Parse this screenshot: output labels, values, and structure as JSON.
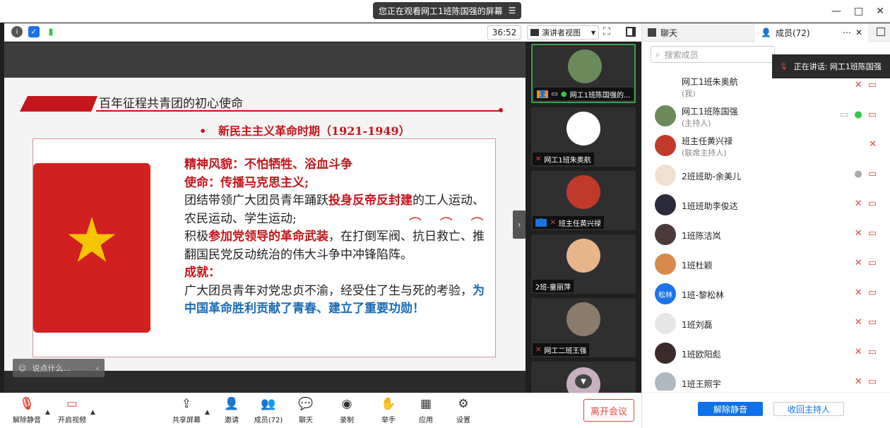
{
  "titlebar": {
    "share_notice": "您正在观看网工1班陈国强的屏幕",
    "menu_icon": "menu-lines-icon",
    "controls": [
      "—",
      "□",
      "✕"
    ]
  },
  "subbar": {
    "timer": "36:52",
    "view_select": "演讲者视图"
  },
  "slide": {
    "banner_title": "百年征程共青团的初心使命",
    "subtitle_bullet": "•",
    "subtitle": "新民主主义革命时期（1921-1949）",
    "spirit_label": "精神风貌：不怕牺牲、浴血斗争",
    "mission_label": "使命：传播马克思主义;",
    "p1_a": "团结带领广大团员青年踊跃",
    "p1_em": "投身反帝反封建",
    "p1_b": "的工人运动、农民运动、学生运动;",
    "p2_a": "积极",
    "p2_em": "参加党领导的革命武装",
    "p2_b": "，在打倒军阀、抗日救亡、推翻国民党反动统治的伟大斗争中冲锋陷阵。",
    "achieve_label": "成就：",
    "p3_a": "广大团员青年对党忠贞不渝，经受住了生与死的考验，",
    "p3_em": "为中国革命胜利贡献了青春、建立了重要功勋！"
  },
  "chat_input": {
    "placeholder": "说点什么...",
    "collapse": "‹"
  },
  "video_tiles": [
    {
      "name": "网工1班陈国强的...",
      "active": true,
      "muted": false,
      "avatar_color": "#6a8a5a"
    },
    {
      "name": "网工1班朱奥航",
      "active": false,
      "muted": true,
      "avatar_color": "#ffffff"
    },
    {
      "name": "班主任黄兴禄",
      "active": false,
      "muted": true,
      "avatar_color": "#c0392b"
    },
    {
      "name": "2班-童丽萍",
      "active": false,
      "muted": false,
      "avatar_color": "#e8b48a"
    },
    {
      "name": "网工二班王强",
      "active": false,
      "muted": true,
      "avatar_color": "#8a7b6b"
    }
  ],
  "panel": {
    "tab_chat": "聊天",
    "tab_members": "成员(72)",
    "search_placeholder": "搜索成员",
    "speaking": "正在讲话: 网工1班陈国强",
    "members": [
      {
        "name": "网工1班朱奥航",
        "role": "(我)",
        "avatar_color": "#ffffff",
        "avatar_text": "",
        "icons": [
          "mute",
          "video-off"
        ]
      },
      {
        "name": "网工1班陈国强",
        "role": "(主持人)",
        "avatar_color": "#6a8a5a",
        "avatar_text": "",
        "icons": [
          "screen",
          "mic-on",
          "video-off"
        ]
      },
      {
        "name": "班主任黄兴禄",
        "role": "(联席主持人)",
        "avatar_color": "#c0392b",
        "avatar_text": "",
        "icons": [
          "mute"
        ]
      },
      {
        "name": "2班班助-余美儿",
        "role": "",
        "avatar_color": "#f0e0d0",
        "avatar_text": "",
        "icons": [
          "mic-gray",
          "video-off"
        ]
      },
      {
        "name": "1班班助李俊达",
        "role": "",
        "avatar_color": "#2a2a3a",
        "avatar_text": "",
        "icons": [
          "mute",
          "video-off"
        ]
      },
      {
        "name": "1班陈洁岚",
        "role": "",
        "avatar_color": "#4a3a3a",
        "avatar_text": "",
        "icons": [
          "mute",
          "video-off"
        ]
      },
      {
        "name": "1班杜颖",
        "role": "",
        "avatar_color": "#d98a4a",
        "avatar_text": "",
        "icons": [
          "mute",
          "video-off"
        ]
      },
      {
        "name": "1班-黎松林",
        "role": "",
        "avatar_color": "#1a73e8",
        "avatar_text": "松林",
        "icons": [
          "mute",
          "video-off"
        ]
      },
      {
        "name": "1班刘磊",
        "role": "",
        "avatar_color": "#e6e6e6",
        "avatar_text": "",
        "icons": [
          "mute",
          "video-off"
        ]
      },
      {
        "name": "1班欧阳彪",
        "role": "",
        "avatar_color": "#3a2a2a",
        "avatar_text": "",
        "icons": [
          "mute",
          "video-off"
        ]
      },
      {
        "name": "1班王照宇",
        "role": "",
        "avatar_color": "#b0b8c0",
        "avatar_text": "",
        "icons": [
          "mute",
          "video-off"
        ]
      }
    ],
    "btn_unmute_all": "解除静音",
    "btn_reclaim_host": "收回主持人"
  },
  "toolbar": {
    "unmute": "解除静音",
    "start_video": "开启视频",
    "share": "共享屏幕",
    "invite": "邀请",
    "members": "成员(72)",
    "chat": "聊天",
    "record": "录制",
    "raise_hand": "举手",
    "apps": "应用",
    "settings": "设置",
    "leave": "离开会议"
  },
  "colors": {
    "accent_blue": "#0e71eb",
    "danger_red": "#e0463f",
    "slide_red": "#c4161c",
    "slide_blue": "#1c6bb5",
    "mic_green": "#3bc34a"
  }
}
